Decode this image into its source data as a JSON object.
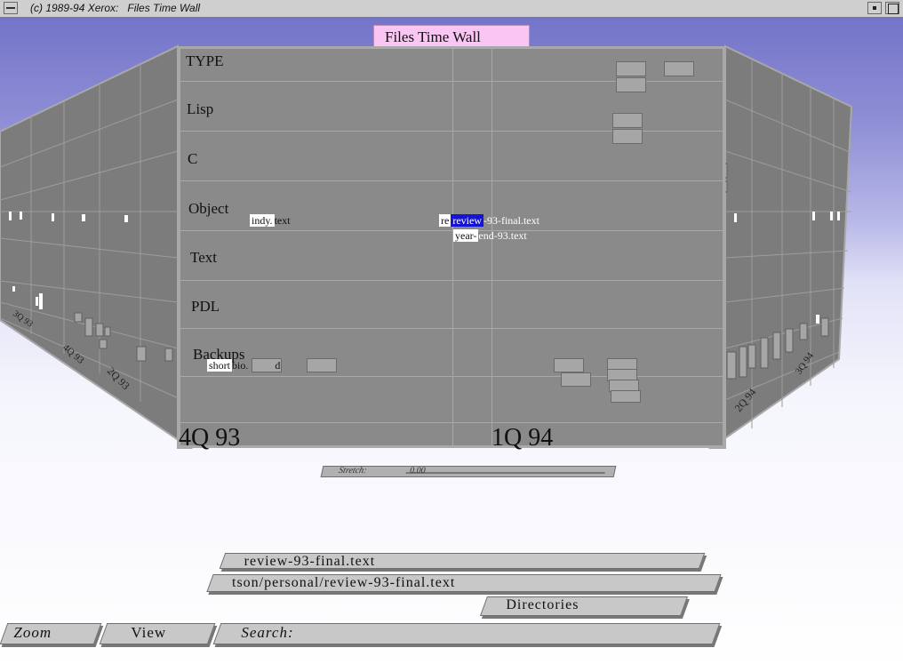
{
  "window": {
    "title": "(c) 1989-94 Xerox:   Files Time Wall"
  },
  "banner": {
    "label": "Files Time Wall"
  },
  "wall": {
    "header": "TYPE",
    "rows": [
      "Lisp",
      "C",
      "Object",
      "Text",
      "PDL",
      "Backups"
    ],
    "quarters": [
      "4Q 93",
      "1Q 94"
    ],
    "files": {
      "indy": {
        "highlight": "indy.",
        "rest": "text"
      },
      "review": {
        "prefix": "re",
        "highlight": "review",
        "rest": "-93-final.text"
      },
      "year_end": {
        "highlight": "year-",
        "rest": "end-93.text"
      },
      "shortbio": {
        "highlight": "short",
        "rest": "bio.",
        "tail": "d"
      }
    }
  },
  "stretch_slider": {
    "label": "Stretch:",
    "value": "0.00"
  },
  "fields": {
    "selected_name": "review-93-final.text",
    "selected_path": "tson/personal/review-93-final.text"
  },
  "buttons": {
    "directories": "Directories",
    "zoom": "Zoom",
    "view": "View",
    "search": "Search:"
  },
  "colors": {
    "sky_top": "#7474c9",
    "wall": "#8a8a8a",
    "banner": "#f9c6f4",
    "selection": "#1414d8"
  }
}
